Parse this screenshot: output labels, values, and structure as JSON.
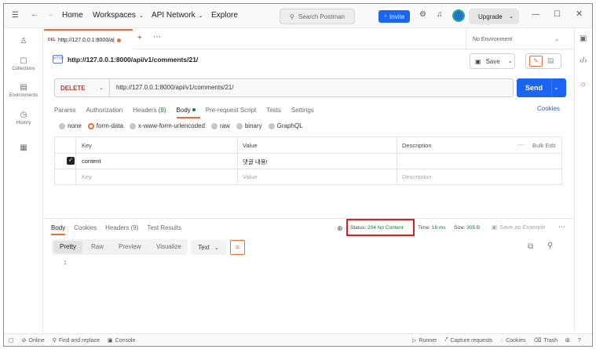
{
  "topbar": {
    "home": "Home",
    "workspaces": "Workspaces",
    "api_network": "API Network",
    "explore": "Explore",
    "search_placeholder": "Search Postman",
    "invite": "Invite",
    "upgrade": "Upgrade"
  },
  "sidebar": {
    "items": [
      {
        "label": "",
        "icon": "user-icon"
      },
      {
        "label": "Collections",
        "icon": "collections-icon"
      },
      {
        "label": "Environments",
        "icon": "environments-icon"
      },
      {
        "label": "History",
        "icon": "history-icon"
      },
      {
        "label": "",
        "icon": "apps-icon"
      }
    ]
  },
  "tabs": {
    "request_tab": {
      "method": "DEL",
      "url": "http://127.0.0.1:8000/a|"
    },
    "environment": "No Environment"
  },
  "request": {
    "title": "http://127.0.0.1:8000/api/v1/comments/21/",
    "save_label": "Save",
    "method": "DELETE",
    "url": "http://127.0.0.1:8000/api/v1/comments/21/",
    "send_label": "Send",
    "tabs": {
      "params": "Params",
      "authorization": "Authorization",
      "headers": "Headers",
      "headers_count": "(8)",
      "body": "Body",
      "pre_request": "Pre-request Script",
      "tests": "Tests",
      "settings": "Settings"
    },
    "cookies_link": "Cookies",
    "body_types": [
      "none",
      "form-data",
      "x-www-form-urlencoded",
      "raw",
      "binary",
      "GraphQL"
    ],
    "body_type_selected": "form-data",
    "table": {
      "headers": {
        "key": "Key",
        "value": "Value",
        "description": "Description",
        "bulk_edit": "Bulk Edit"
      },
      "rows": [
        {
          "checked": true,
          "key": "content",
          "value": "댓글 내용!",
          "description": ""
        }
      ],
      "placeholder": {
        "key": "Key",
        "value": "Value",
        "description": "Description"
      }
    }
  },
  "response": {
    "tabs": {
      "body": "Body",
      "cookies": "Cookies",
      "headers": "Headers",
      "headers_count": "(9)",
      "test_results": "Test Results"
    },
    "status_label": "Status:",
    "status_value": "204 No Content",
    "time_label": "Time:",
    "time_value": "16 ms",
    "size_label": "Size:",
    "size_value": "305 B",
    "save_as_example": "Save as Example",
    "view_modes": [
      "Pretty",
      "Raw",
      "Preview",
      "Visualize"
    ],
    "format": "Text",
    "line_number": "1"
  },
  "statusbar": {
    "online": "Online",
    "find_replace": "Find and replace",
    "console": "Console",
    "runner": "Runner",
    "capture": "Capture requests",
    "cookies": "Cookies",
    "trash": "Trash"
  },
  "colors": {
    "accent": "#f26b3a",
    "primary": "#1c64f2",
    "delete_method": "#c0392b",
    "status_ok": "#0c7d3a",
    "highlight_box": "#e01e1e"
  }
}
